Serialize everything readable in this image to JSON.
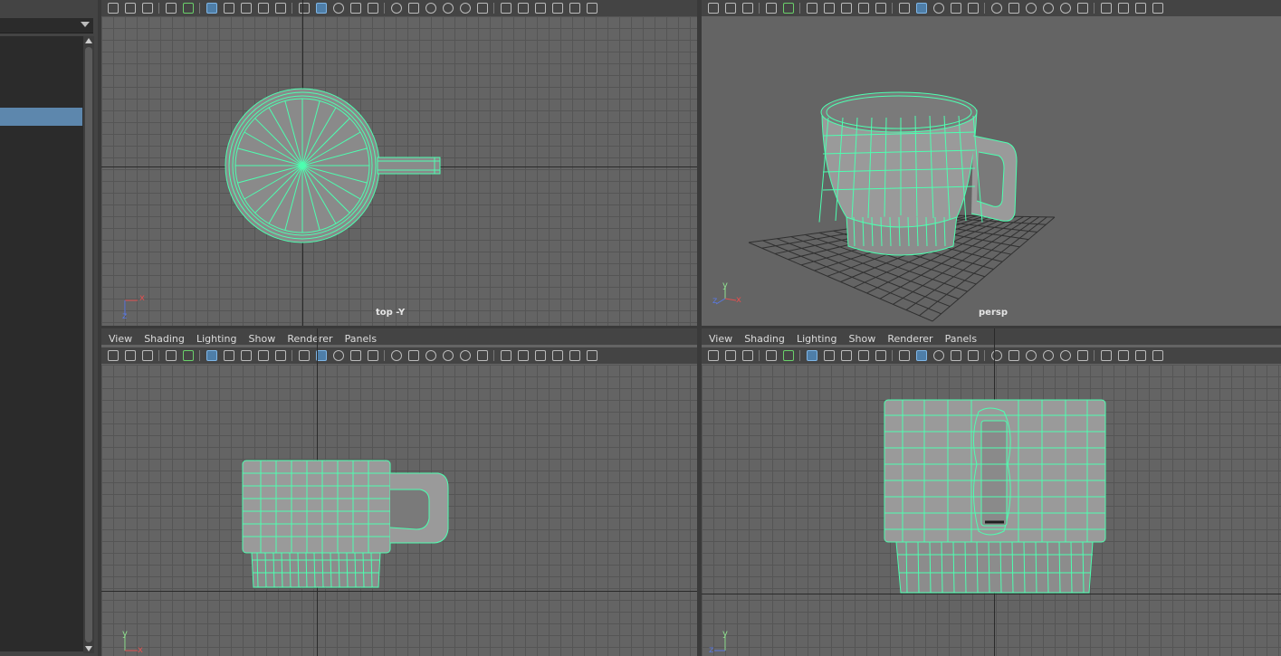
{
  "menu": {
    "view": "View",
    "shading": "Shading",
    "lighting": "Lighting",
    "show": "Show",
    "renderer": "Renderer",
    "panels": "Panels"
  },
  "viewports": {
    "top": {
      "label": "top -Y"
    },
    "persp": {
      "label": "persp"
    },
    "front": {
      "label": ""
    },
    "side": {
      "label": ""
    }
  },
  "gizmo": {
    "x": "x",
    "y": "y",
    "z": "z"
  },
  "toolbar_icons": [
    "select-camera-icon",
    "camera-attributes-icon",
    "bookmark-icon",
    "image-plane-icon",
    "grease-pencil-icon",
    "grid-icon",
    "film-gate-icon",
    "resolution-gate-icon",
    "safe-action-icon",
    "wireframe-icon",
    "smooth-shade-icon",
    "textured-icon",
    "lighting-icon",
    "shadows-icon",
    "isolate-icon",
    "xray-icon"
  ],
  "colors": {
    "wire": "#4dffb0",
    "selection": "#5d87ad",
    "viewport_bg": "#646464"
  }
}
